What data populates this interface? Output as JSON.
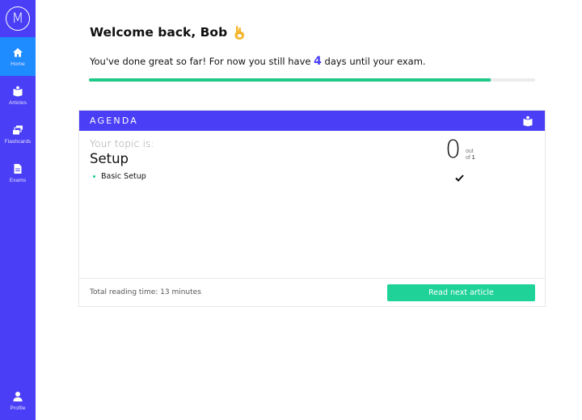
{
  "sidebar": {
    "logo_text": "M",
    "items": [
      {
        "label": "Home",
        "icon": "home-icon",
        "active": true
      },
      {
        "label": "Articles",
        "icon": "book-icon",
        "active": false
      },
      {
        "label": "Flashcards",
        "icon": "cards-icon",
        "active": false
      },
      {
        "label": "Exams",
        "icon": "document-icon",
        "active": false
      }
    ],
    "profile": {
      "label": "Profile",
      "icon": "user-icon"
    }
  },
  "header": {
    "welcome": "Welcome back, Bob",
    "status_prefix": "You've done great so far! For now you still have ",
    "days_left": "4",
    "status_suffix": " days until your exam.",
    "progress_fraction": 0.9
  },
  "agenda": {
    "title": "AGENDA",
    "topic_label": "Your topic is:",
    "topic_name": "Setup",
    "subtopics": [
      "Basic Setup"
    ],
    "completed_count": "0",
    "out_label": "out",
    "of_label": "of",
    "total_count": "1",
    "reading_time": "Total reading time: 13 minutes",
    "next_button": "Read next article"
  },
  "colors": {
    "brand": "#4a3ff7",
    "active_nav": "#1e8bff",
    "accent_green": "#1fd398"
  }
}
